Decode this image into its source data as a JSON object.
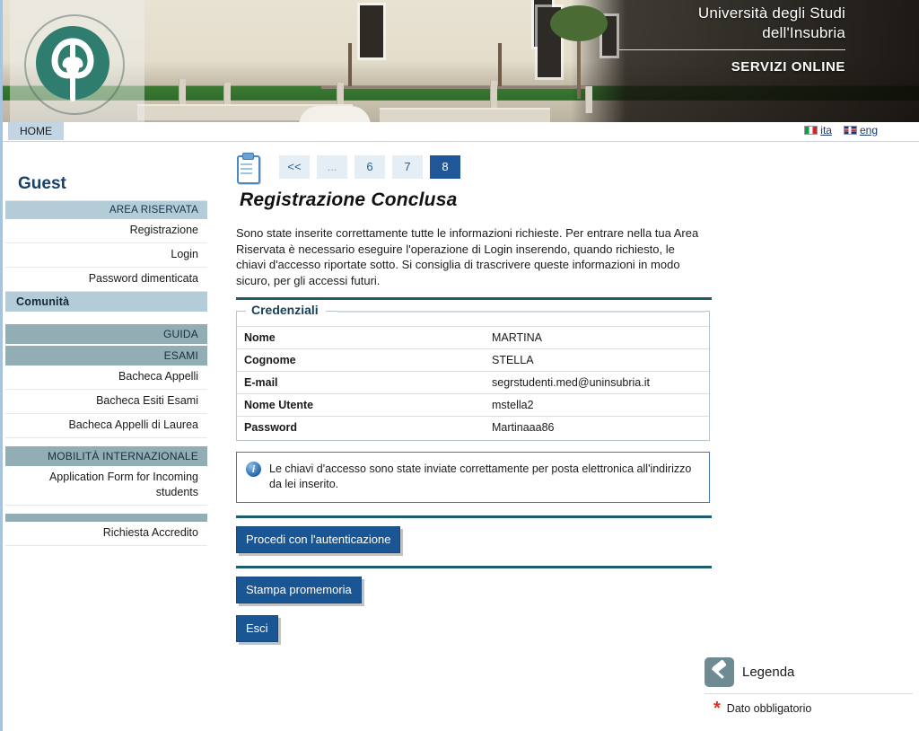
{
  "banner": {
    "university_line1": "Università degli Studi",
    "university_line2": "dell'Insubria",
    "services": "SERVIZI ONLINE",
    "logo_name": "insubria-seal-logo"
  },
  "topbar": {
    "home_label": "HOME",
    "languages": [
      {
        "code": "ita",
        "label": "ita",
        "flag": "flag-italy-icon"
      },
      {
        "code": "eng",
        "label": "eng",
        "flag": "flag-uk-icon"
      }
    ]
  },
  "sidebar": {
    "user": "Guest",
    "sections": [
      {
        "header": "AREA RISERVATA",
        "style": "light",
        "items": [
          "Registrazione",
          "Login",
          "Password dimenticata"
        ]
      },
      {
        "header": "Comunità",
        "style": "light-left",
        "items": []
      },
      {
        "header": "GUIDA",
        "style": "dark",
        "items": []
      },
      {
        "header": "ESAMI",
        "style": "dark",
        "items": [
          "Bacheca Appelli",
          "Bacheca Esiti Esami",
          "Bacheca Appelli di Laurea"
        ]
      },
      {
        "header": "MOBILITÀ INTERNAZIONALE",
        "style": "dark",
        "items": [
          "Application Form for Incoming students"
        ]
      },
      {
        "header": "",
        "style": "dark",
        "items": [
          "Richiesta Accredito"
        ]
      }
    ]
  },
  "content": {
    "clipboard_icon": "clipboard-checklist-icon",
    "pagination": [
      {
        "label": "<<",
        "active": false,
        "kind": "prev"
      },
      {
        "label": "...",
        "active": false,
        "kind": "dots"
      },
      {
        "label": "6",
        "active": false,
        "kind": "page"
      },
      {
        "label": "7",
        "active": false,
        "kind": "page"
      },
      {
        "label": "8",
        "active": true,
        "kind": "page"
      }
    ],
    "title": "Registrazione Conclusa",
    "intro": "Sono state inserite correttamente tutte le informazioni richieste. Per entrare nella tua Area Riservata è necessario eseguire l'operazione di Login inserendo, quando richiesto, le chiavi d'accesso riportate sotto. Si consiglia di trascrivere queste informazioni in modo sicuro, per gli accessi futuri.",
    "credentials": {
      "legend": "Credenziali",
      "rows": [
        {
          "key": "Nome",
          "value": "MARTINA"
        },
        {
          "key": "Cognome",
          "value": "STELLA"
        },
        {
          "key": "E-mail",
          "value": "segrstudenti.med@uninsubria.it"
        },
        {
          "key": "Nome Utente",
          "value": "mstella2"
        },
        {
          "key": "Password",
          "value": "Martinaaa86"
        }
      ]
    },
    "info": {
      "icon": "info-circle-icon",
      "text": "Le chiavi d'accesso sono state inviate correttamente per posta elettronica all'indirizzo da lei inserito."
    },
    "buttons": [
      {
        "label": "Procedi con l'autenticazione"
      },
      {
        "label": "Stampa promemoria"
      },
      {
        "label": "Esci"
      }
    ]
  },
  "legenda": {
    "icon": "pushpin-icon",
    "title": "Legenda",
    "required_symbol": "*",
    "required_label": "Dato obbligatorio"
  },
  "colors": {
    "accent_blue": "#1a5693",
    "rule_teal": "#1d5b6e",
    "sidebar_light": "#b4cbd8",
    "sidebar_dark": "#93adb4",
    "required_red": "#e03020"
  }
}
